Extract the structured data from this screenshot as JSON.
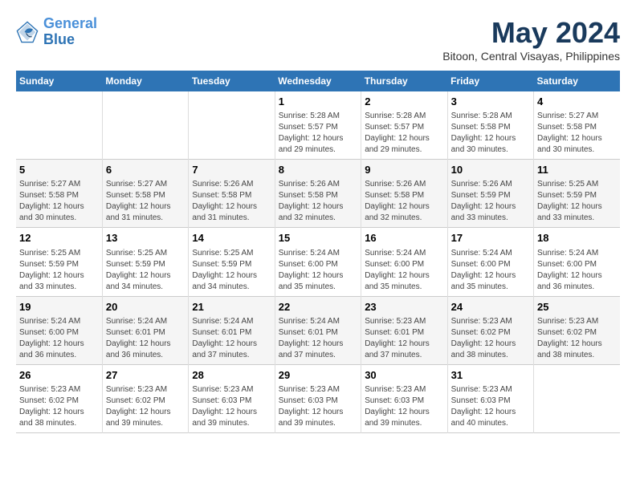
{
  "logo": {
    "line1": "General",
    "line2": "Blue"
  },
  "title": "May 2024",
  "subtitle": "Bitoon, Central Visayas, Philippines",
  "days_of_week": [
    "Sunday",
    "Monday",
    "Tuesday",
    "Wednesday",
    "Thursday",
    "Friday",
    "Saturday"
  ],
  "weeks": [
    [
      {
        "day": "",
        "info": ""
      },
      {
        "day": "",
        "info": ""
      },
      {
        "day": "",
        "info": ""
      },
      {
        "day": "1",
        "info": "Sunrise: 5:28 AM\nSunset: 5:57 PM\nDaylight: 12 hours and 29 minutes."
      },
      {
        "day": "2",
        "info": "Sunrise: 5:28 AM\nSunset: 5:57 PM\nDaylight: 12 hours and 29 minutes."
      },
      {
        "day": "3",
        "info": "Sunrise: 5:28 AM\nSunset: 5:58 PM\nDaylight: 12 hours and 30 minutes."
      },
      {
        "day": "4",
        "info": "Sunrise: 5:27 AM\nSunset: 5:58 PM\nDaylight: 12 hours and 30 minutes."
      }
    ],
    [
      {
        "day": "5",
        "info": "Sunrise: 5:27 AM\nSunset: 5:58 PM\nDaylight: 12 hours and 30 minutes."
      },
      {
        "day": "6",
        "info": "Sunrise: 5:27 AM\nSunset: 5:58 PM\nDaylight: 12 hours and 31 minutes."
      },
      {
        "day": "7",
        "info": "Sunrise: 5:26 AM\nSunset: 5:58 PM\nDaylight: 12 hours and 31 minutes."
      },
      {
        "day": "8",
        "info": "Sunrise: 5:26 AM\nSunset: 5:58 PM\nDaylight: 12 hours and 32 minutes."
      },
      {
        "day": "9",
        "info": "Sunrise: 5:26 AM\nSunset: 5:58 PM\nDaylight: 12 hours and 32 minutes."
      },
      {
        "day": "10",
        "info": "Sunrise: 5:26 AM\nSunset: 5:59 PM\nDaylight: 12 hours and 33 minutes."
      },
      {
        "day": "11",
        "info": "Sunrise: 5:25 AM\nSunset: 5:59 PM\nDaylight: 12 hours and 33 minutes."
      }
    ],
    [
      {
        "day": "12",
        "info": "Sunrise: 5:25 AM\nSunset: 5:59 PM\nDaylight: 12 hours and 33 minutes."
      },
      {
        "day": "13",
        "info": "Sunrise: 5:25 AM\nSunset: 5:59 PM\nDaylight: 12 hours and 34 minutes."
      },
      {
        "day": "14",
        "info": "Sunrise: 5:25 AM\nSunset: 5:59 PM\nDaylight: 12 hours and 34 minutes."
      },
      {
        "day": "15",
        "info": "Sunrise: 5:24 AM\nSunset: 6:00 PM\nDaylight: 12 hours and 35 minutes."
      },
      {
        "day": "16",
        "info": "Sunrise: 5:24 AM\nSunset: 6:00 PM\nDaylight: 12 hours and 35 minutes."
      },
      {
        "day": "17",
        "info": "Sunrise: 5:24 AM\nSunset: 6:00 PM\nDaylight: 12 hours and 35 minutes."
      },
      {
        "day": "18",
        "info": "Sunrise: 5:24 AM\nSunset: 6:00 PM\nDaylight: 12 hours and 36 minutes."
      }
    ],
    [
      {
        "day": "19",
        "info": "Sunrise: 5:24 AM\nSunset: 6:00 PM\nDaylight: 12 hours and 36 minutes."
      },
      {
        "day": "20",
        "info": "Sunrise: 5:24 AM\nSunset: 6:01 PM\nDaylight: 12 hours and 36 minutes."
      },
      {
        "day": "21",
        "info": "Sunrise: 5:24 AM\nSunset: 6:01 PM\nDaylight: 12 hours and 37 minutes."
      },
      {
        "day": "22",
        "info": "Sunrise: 5:24 AM\nSunset: 6:01 PM\nDaylight: 12 hours and 37 minutes."
      },
      {
        "day": "23",
        "info": "Sunrise: 5:23 AM\nSunset: 6:01 PM\nDaylight: 12 hours and 37 minutes."
      },
      {
        "day": "24",
        "info": "Sunrise: 5:23 AM\nSunset: 6:02 PM\nDaylight: 12 hours and 38 minutes."
      },
      {
        "day": "25",
        "info": "Sunrise: 5:23 AM\nSunset: 6:02 PM\nDaylight: 12 hours and 38 minutes."
      }
    ],
    [
      {
        "day": "26",
        "info": "Sunrise: 5:23 AM\nSunset: 6:02 PM\nDaylight: 12 hours and 38 minutes."
      },
      {
        "day": "27",
        "info": "Sunrise: 5:23 AM\nSunset: 6:02 PM\nDaylight: 12 hours and 39 minutes."
      },
      {
        "day": "28",
        "info": "Sunrise: 5:23 AM\nSunset: 6:03 PM\nDaylight: 12 hours and 39 minutes."
      },
      {
        "day": "29",
        "info": "Sunrise: 5:23 AM\nSunset: 6:03 PM\nDaylight: 12 hours and 39 minutes."
      },
      {
        "day": "30",
        "info": "Sunrise: 5:23 AM\nSunset: 6:03 PM\nDaylight: 12 hours and 39 minutes."
      },
      {
        "day": "31",
        "info": "Sunrise: 5:23 AM\nSunset: 6:03 PM\nDaylight: 12 hours and 40 minutes."
      },
      {
        "day": "",
        "info": ""
      }
    ]
  ]
}
